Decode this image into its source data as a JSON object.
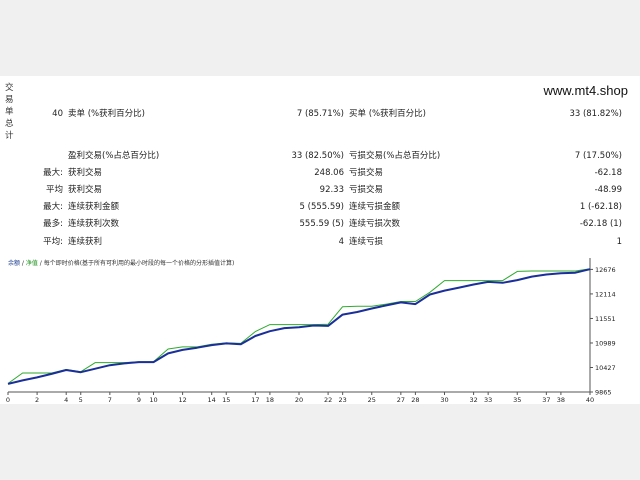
{
  "watermark": "www.mt4.shop",
  "side_label": [
    "交",
    "易",
    "单",
    "总",
    "计"
  ],
  "summary": {
    "total_trades": "40",
    "short_label": "卖单 (%获利百分比)",
    "short_value": "7 (85.71%)",
    "long_label": "买单 (%获利百分比)",
    "long_value": "33 (81.82%)",
    "profit_trades_label": "盈利交易(%占总百分比)",
    "profit_trades_value": "33 (82.50%)",
    "loss_trades_label": "亏损交易(%占总百分比)",
    "loss_trades_value": "7 (17.50%)",
    "largest_prefix": "最大:",
    "largest_profit_label": "获利交易",
    "largest_profit_value": "248.06",
    "largest_loss_label": "亏损交易",
    "largest_loss_value": "-62.18",
    "average_prefix": "平均",
    "average_profit_label": "获利交易",
    "average_profit_value": "92.33",
    "average_loss_label": "亏损交易",
    "average_loss_value": "-48.99",
    "max_prefix": "最大:",
    "max_consec_wins_label": "连续获利金额",
    "max_consec_wins_value": "5 (555.59)",
    "max_consec_losses_label": "连续亏损金额",
    "max_consec_losses_value": "1 (-62.18)",
    "maximal_prefix": "最多:",
    "maximal_consec_profit_label": "连续获利次数",
    "maximal_consec_profit_value": "555.59 (5)",
    "maximal_consec_loss_label": "连续亏损次数",
    "maximal_consec_loss_value": "-62.18 (1)",
    "avg_consec_prefix": "平均:",
    "avg_consec_wins_label": "连续获利",
    "avg_consec_wins_value": "4",
    "avg_consec_losses_label": "连续亏损",
    "avg_consec_losses_value": "1"
  },
  "legend": {
    "balance": "余额",
    "sep1": " / ",
    "equity": "净值",
    "sep2": " / ",
    "note": "每个即时价格(基于所有可利用的最小时段的每一个价格的分形插值计算)"
  },
  "colors": {
    "balance": "#1a2f99",
    "equity": "#2eaa2e"
  },
  "chart_data": {
    "type": "line",
    "xlabel": "",
    "ylabel": "",
    "x_ticks": [
      0,
      2,
      4,
      5,
      7,
      9,
      10,
      12,
      14,
      15,
      17,
      18,
      20,
      22,
      23,
      25,
      27,
      28,
      30,
      32,
      33,
      35,
      37,
      38,
      40
    ],
    "y_ticks": [
      9865,
      10427,
      10989,
      11551,
      12114,
      12676
    ],
    "xlim": [
      0,
      40
    ],
    "ylim": [
      9865,
      12800
    ],
    "grid": false,
    "series": [
      {
        "name": "余额",
        "x": [
          0,
          1,
          2,
          3,
          4,
          5,
          6,
          7,
          8,
          9,
          10,
          11,
          12,
          13,
          14,
          15,
          16,
          17,
          18,
          19,
          20,
          21,
          22,
          23,
          24,
          25,
          26,
          27,
          28,
          29,
          30,
          31,
          32,
          33,
          34,
          35,
          36,
          37,
          38,
          39,
          40
        ],
        "values": [
          10050,
          10130,
          10200,
          10280,
          10370,
          10320,
          10400,
          10480,
          10520,
          10550,
          10550,
          10750,
          10830,
          10880,
          10940,
          10980,
          10960,
          11150,
          11260,
          11330,
          11350,
          11390,
          11380,
          11640,
          11700,
          11780,
          11850,
          11920,
          11880,
          12100,
          12190,
          12260,
          12330,
          12390,
          12370,
          12430,
          12510,
          12560,
          12590,
          12600,
          12680
        ]
      },
      {
        "name": "净值",
        "x": [
          0,
          1,
          2,
          3,
          4,
          5,
          6,
          7,
          8,
          9,
          10,
          11,
          12,
          13,
          14,
          15,
          16,
          17,
          18,
          19,
          20,
          21,
          22,
          23,
          24,
          25,
          26,
          27,
          28,
          29,
          30,
          31,
          32,
          33,
          34,
          35,
          36,
          37,
          38,
          39,
          40
        ],
        "values": [
          10060,
          10300,
          10300,
          10300,
          10380,
          10330,
          10540,
          10540,
          10540,
          10560,
          10560,
          10850,
          10900,
          10900,
          10960,
          10990,
          10980,
          11250,
          11410,
          11410,
          11410,
          11410,
          11420,
          11820,
          11830,
          11830,
          11880,
          11940,
          11940,
          12150,
          12420,
          12420,
          12420,
          12420,
          12420,
          12630,
          12640,
          12640,
          12640,
          12640,
          12690
        ]
      }
    ]
  }
}
